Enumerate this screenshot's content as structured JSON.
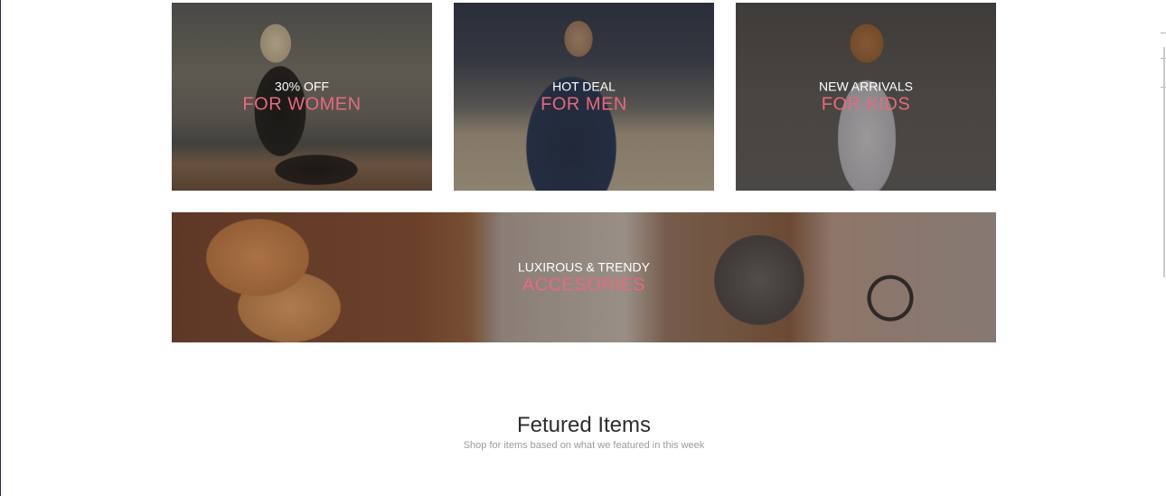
{
  "promos": {
    "women": {
      "small": "30% OFF",
      "big": "FOR WOMEN"
    },
    "men": {
      "small": "HOT DEAL",
      "big": "FOR MEN"
    },
    "kids": {
      "small": "NEW ARRIVALS",
      "big": "FOR KIDS"
    },
    "accessories": {
      "small": "LUXIROUS & TRENDY",
      "big": "ACCESORIES"
    }
  },
  "featured": {
    "title": "Fetured Items",
    "subtitle": "Shop for items based on what we featured in this week"
  },
  "colors": {
    "accent": "#e66a7e",
    "caption_white": "#ffffff",
    "title_text": "#2d2d2d",
    "subtitle_text": "#9b9b9b"
  }
}
